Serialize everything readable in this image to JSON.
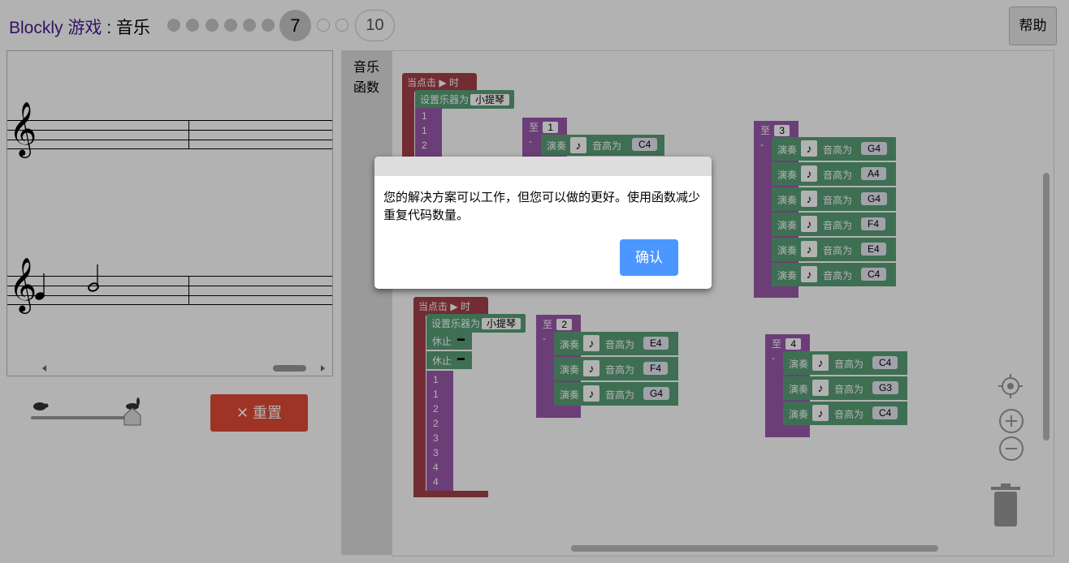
{
  "header": {
    "brand": "Blockly 游戏",
    "separator": " : ",
    "game": "音乐",
    "current_level": "7",
    "max_level": "10",
    "help_label": "帮助"
  },
  "controls": {
    "reset_label": "重置"
  },
  "toolbox": {
    "categories": [
      "音乐",
      "函数"
    ]
  },
  "blocks": {
    "when_clicked": "当点击",
    "when_suffix": "时",
    "set_instrument": "设置乐器为",
    "instrument": "小提琴",
    "rest": "休止",
    "to": "至",
    "dash": "-",
    "play": "演奏",
    "pitch_label": "音高为",
    "func1_id": "1",
    "func1_pitches": [
      "C4"
    ],
    "func2_id": "2",
    "func2_pitches": [
      "E4",
      "F4",
      "G4"
    ],
    "func3_id": "3",
    "func3_pitches": [
      "G4",
      "A4",
      "G4",
      "F4",
      "E4",
      "C4"
    ],
    "func4_id": "4",
    "func4_pitches": [
      "C4",
      "G3",
      "C4"
    ],
    "calls_top": [
      "1",
      "1",
      "2"
    ],
    "calls_bottom": [
      "1",
      "1",
      "2",
      "2",
      "3",
      "3",
      "4",
      "4"
    ]
  },
  "dialog": {
    "message": "您的解决方案可以工作，但您可以做的更好。使用函数减少重复代码数量。",
    "ok_label": "确认"
  }
}
